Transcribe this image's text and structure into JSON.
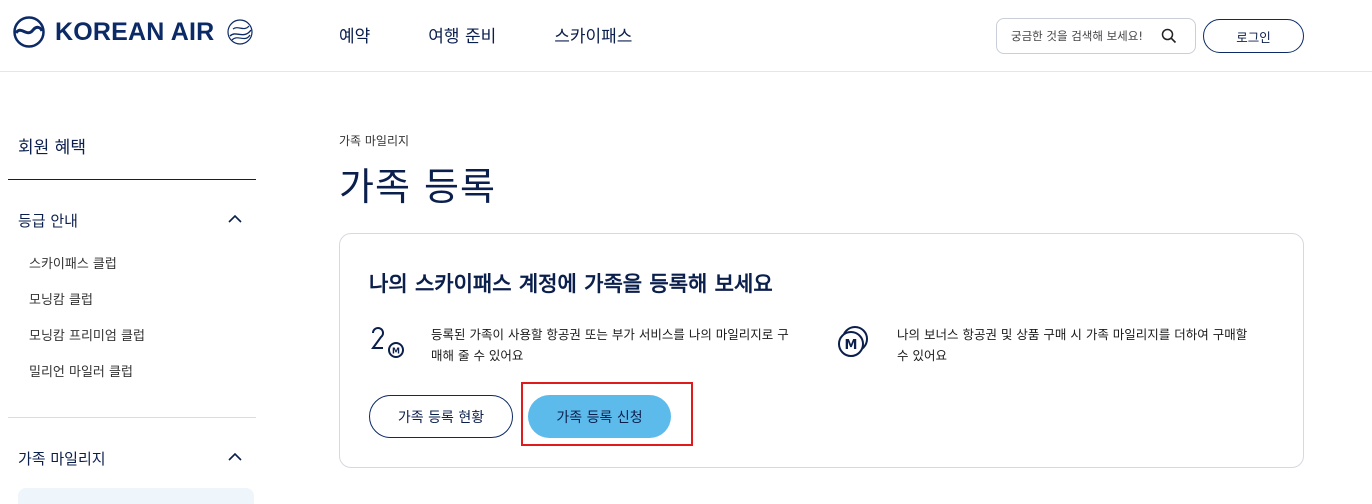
{
  "header": {
    "logo_text": "KOREAN AIR",
    "nav": [
      "예약",
      "여행 준비",
      "스카이패스"
    ],
    "search_placeholder": "궁금한 것을 검색해 보세요!",
    "login_label": "로그인"
  },
  "sidebar": {
    "title": "회원 혜택",
    "groups": [
      {
        "label": "등급 안내",
        "expanded": true,
        "items": [
          "스카이패스 클럽",
          "모닝캄 클럽",
          "모닝캄 프리미엄 클럽",
          "밀리언 마일러 클럽"
        ]
      },
      {
        "label": "가족 마일리지",
        "expanded": true,
        "items": []
      }
    ]
  },
  "main": {
    "breadcrumb": "가족 마일리지",
    "title": "가족 등록",
    "card": {
      "title": "나의 스카이패스 계정에 가족을 등록해 보세요",
      "benefits": [
        {
          "icon": "family-mileage-icon",
          "text": "등록된 가족이 사용할 항공권 또는 부가 서비스를 나의 마일리지로 구매해 줄 수 있어요"
        },
        {
          "icon": "mileage-coins-icon",
          "text": "나의 보너스 항공권 및 상품 구매 시 가족 마일리지를 더하여 구매할 수 있어요"
        }
      ],
      "status_button": "가족 등록 현황",
      "apply_button": "가족 등록 신청"
    }
  },
  "colors": {
    "navy": "#0b1f4d",
    "accent_button": "#5dbbec",
    "highlight_box": "#e01b1b"
  }
}
